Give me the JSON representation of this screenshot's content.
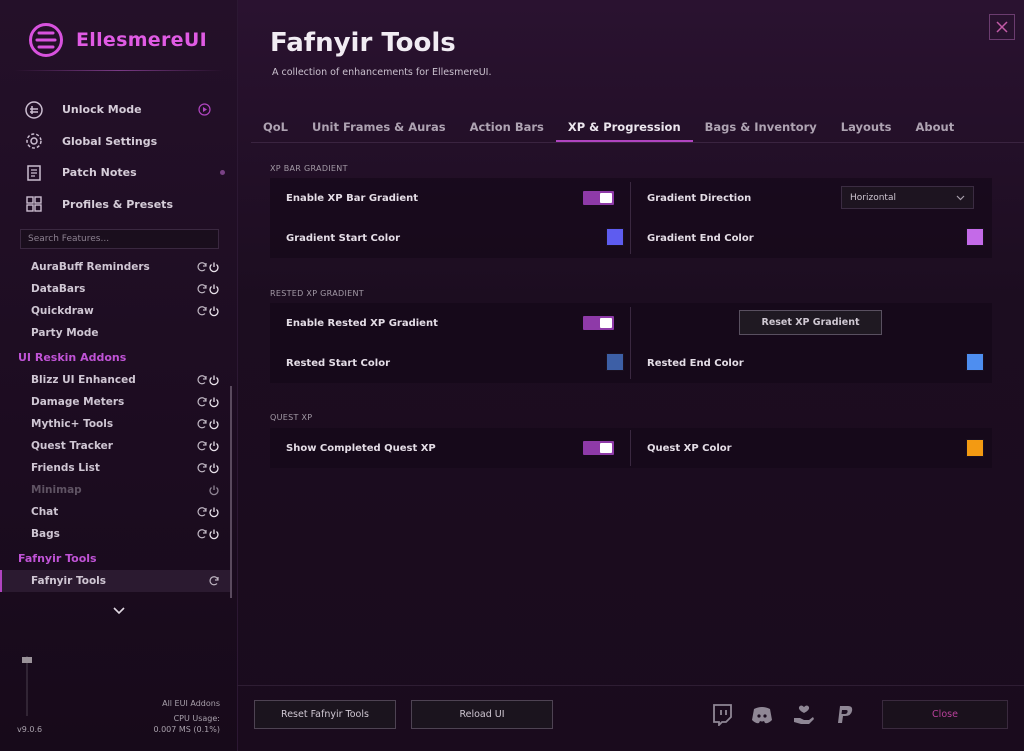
{
  "app": {
    "name": "EllesmereUI",
    "version": "v9.0.6"
  },
  "top_nav": [
    {
      "label": "Unlock Mode",
      "icon": "unlock-mode-icon",
      "trail": "play-icon"
    },
    {
      "label": "Global Settings",
      "icon": "gear-icon"
    },
    {
      "label": "Patch Notes",
      "icon": "notes-icon",
      "trail": "dot"
    },
    {
      "label": "Profiles & Presets",
      "icon": "grid-icon"
    }
  ],
  "search": {
    "placeholder": "Search Features..."
  },
  "sidebar_items_a": [
    "AuraBuff Reminders",
    "DataBars",
    "Quickdraw",
    "Party Mode"
  ],
  "section_reskin": "UI Reskin Addons",
  "sidebar_items_b": [
    "Blizz UI Enhanced",
    "Damage Meters",
    "Mythic+ Tools",
    "Quest Tracker",
    "Friends List",
    "Minimap",
    "Chat",
    "Bags"
  ],
  "section_fafnyir": "Fafnyir Tools",
  "sidebar_active": "Fafnyir Tools",
  "cpu": {
    "scope": "All EUI Addons",
    "label": "CPU Usage:",
    "value": "0.007 MS (0.1%)"
  },
  "header": {
    "title": "Fafnyir Tools",
    "subtitle": "A collection of enhancements for EllesmereUI."
  },
  "tabs": [
    "QoL",
    "Unit Frames & Auras",
    "Action Bars",
    "XP & Progression",
    "Bags & Inventory",
    "Layouts",
    "About"
  ],
  "active_tab": "XP & Progression",
  "xp_gradient": {
    "heading": "XP BAR GRADIENT",
    "enable_label": "Enable XP Bar Gradient",
    "enable_on": true,
    "direction_label": "Gradient Direction",
    "direction_value": "Horizontal",
    "start_label": "Gradient Start Color",
    "start_color": "#5e5cf0",
    "end_label": "Gradient End Color",
    "end_color": "#c46ae8"
  },
  "rested": {
    "heading": "RESTED XP GRADIENT",
    "enable_label": "Enable Rested XP Gradient",
    "enable_on": true,
    "reset_label": "Reset XP Gradient",
    "start_label": "Rested Start Color",
    "start_color": "#3d5fa6",
    "end_label": "Rested End Color",
    "end_color": "#4e8ef0"
  },
  "quest": {
    "heading": "QUEST XP",
    "show_label": "Show Completed Quest XP",
    "show_on": true,
    "color_label": "Quest XP Color",
    "color": "#f39a12"
  },
  "footer": {
    "reset_label": "Reset Fafnyir Tools",
    "reload_label": "Reload UI",
    "close_label": "Close"
  },
  "social_icons": [
    "twitch-icon",
    "discord-icon",
    "donate-icon",
    "paypal-icon"
  ],
  "colors": {
    "accent": "#b044c0",
    "logo": "#e05be4",
    "close_text": "#b8409a"
  }
}
